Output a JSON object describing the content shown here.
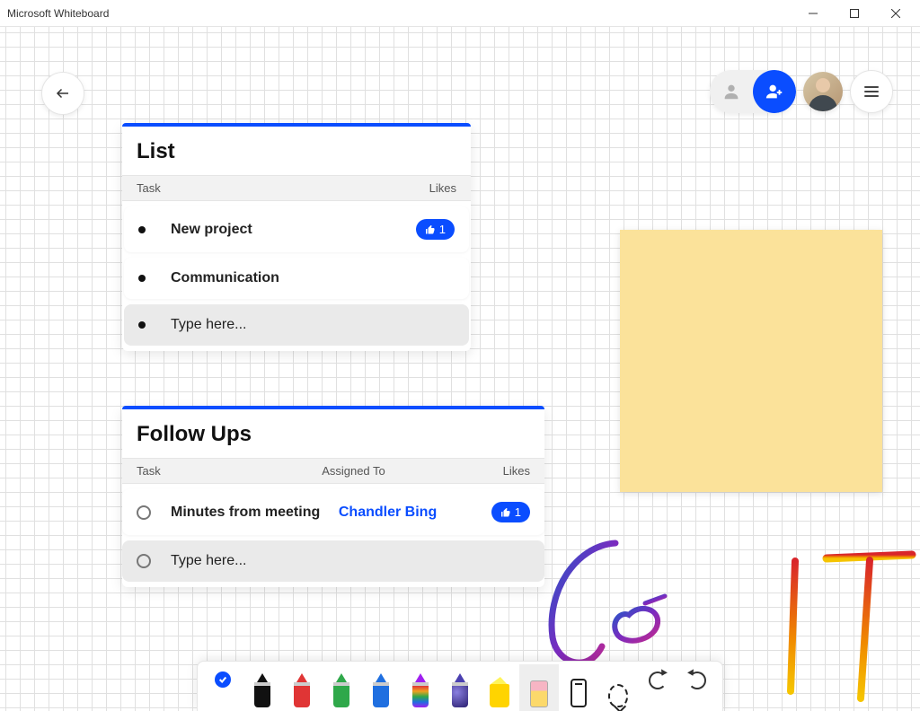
{
  "window": {
    "title": "Microsoft Whiteboard"
  },
  "list_card": {
    "title": "List",
    "columns": {
      "task": "Task",
      "likes": "Likes"
    },
    "rows": [
      {
        "text": "New project",
        "likes": "1"
      },
      {
        "text": "Communication"
      }
    ],
    "placeholder": "Type here..."
  },
  "follow_card": {
    "title": "Follow Ups",
    "columns": {
      "task": "Task",
      "assigned": "Assigned To",
      "likes": "Likes"
    },
    "rows": [
      {
        "text": "Minutes from meeting",
        "assigned": "Chandler Bing",
        "likes": "1"
      }
    ],
    "placeholder": "Type here..."
  },
  "ink": {
    "word1": "Go",
    "word2": "IT"
  },
  "toolbar": {
    "pens": [
      {
        "name": "pen-black",
        "color": "#111111"
      },
      {
        "name": "pen-red",
        "color": "#e03535"
      },
      {
        "name": "pen-green",
        "color": "#2fa84a"
      },
      {
        "name": "pen-blue",
        "color": "#1f6fe0"
      },
      {
        "name": "pen-rainbow",
        "color": "#a020f0"
      },
      {
        "name": "pen-galaxy",
        "color": "#4a3fb0"
      }
    ]
  },
  "colors": {
    "accent": "#0a4dff",
    "sticky": "#fbe29a",
    "highlight": "#fff45a"
  }
}
